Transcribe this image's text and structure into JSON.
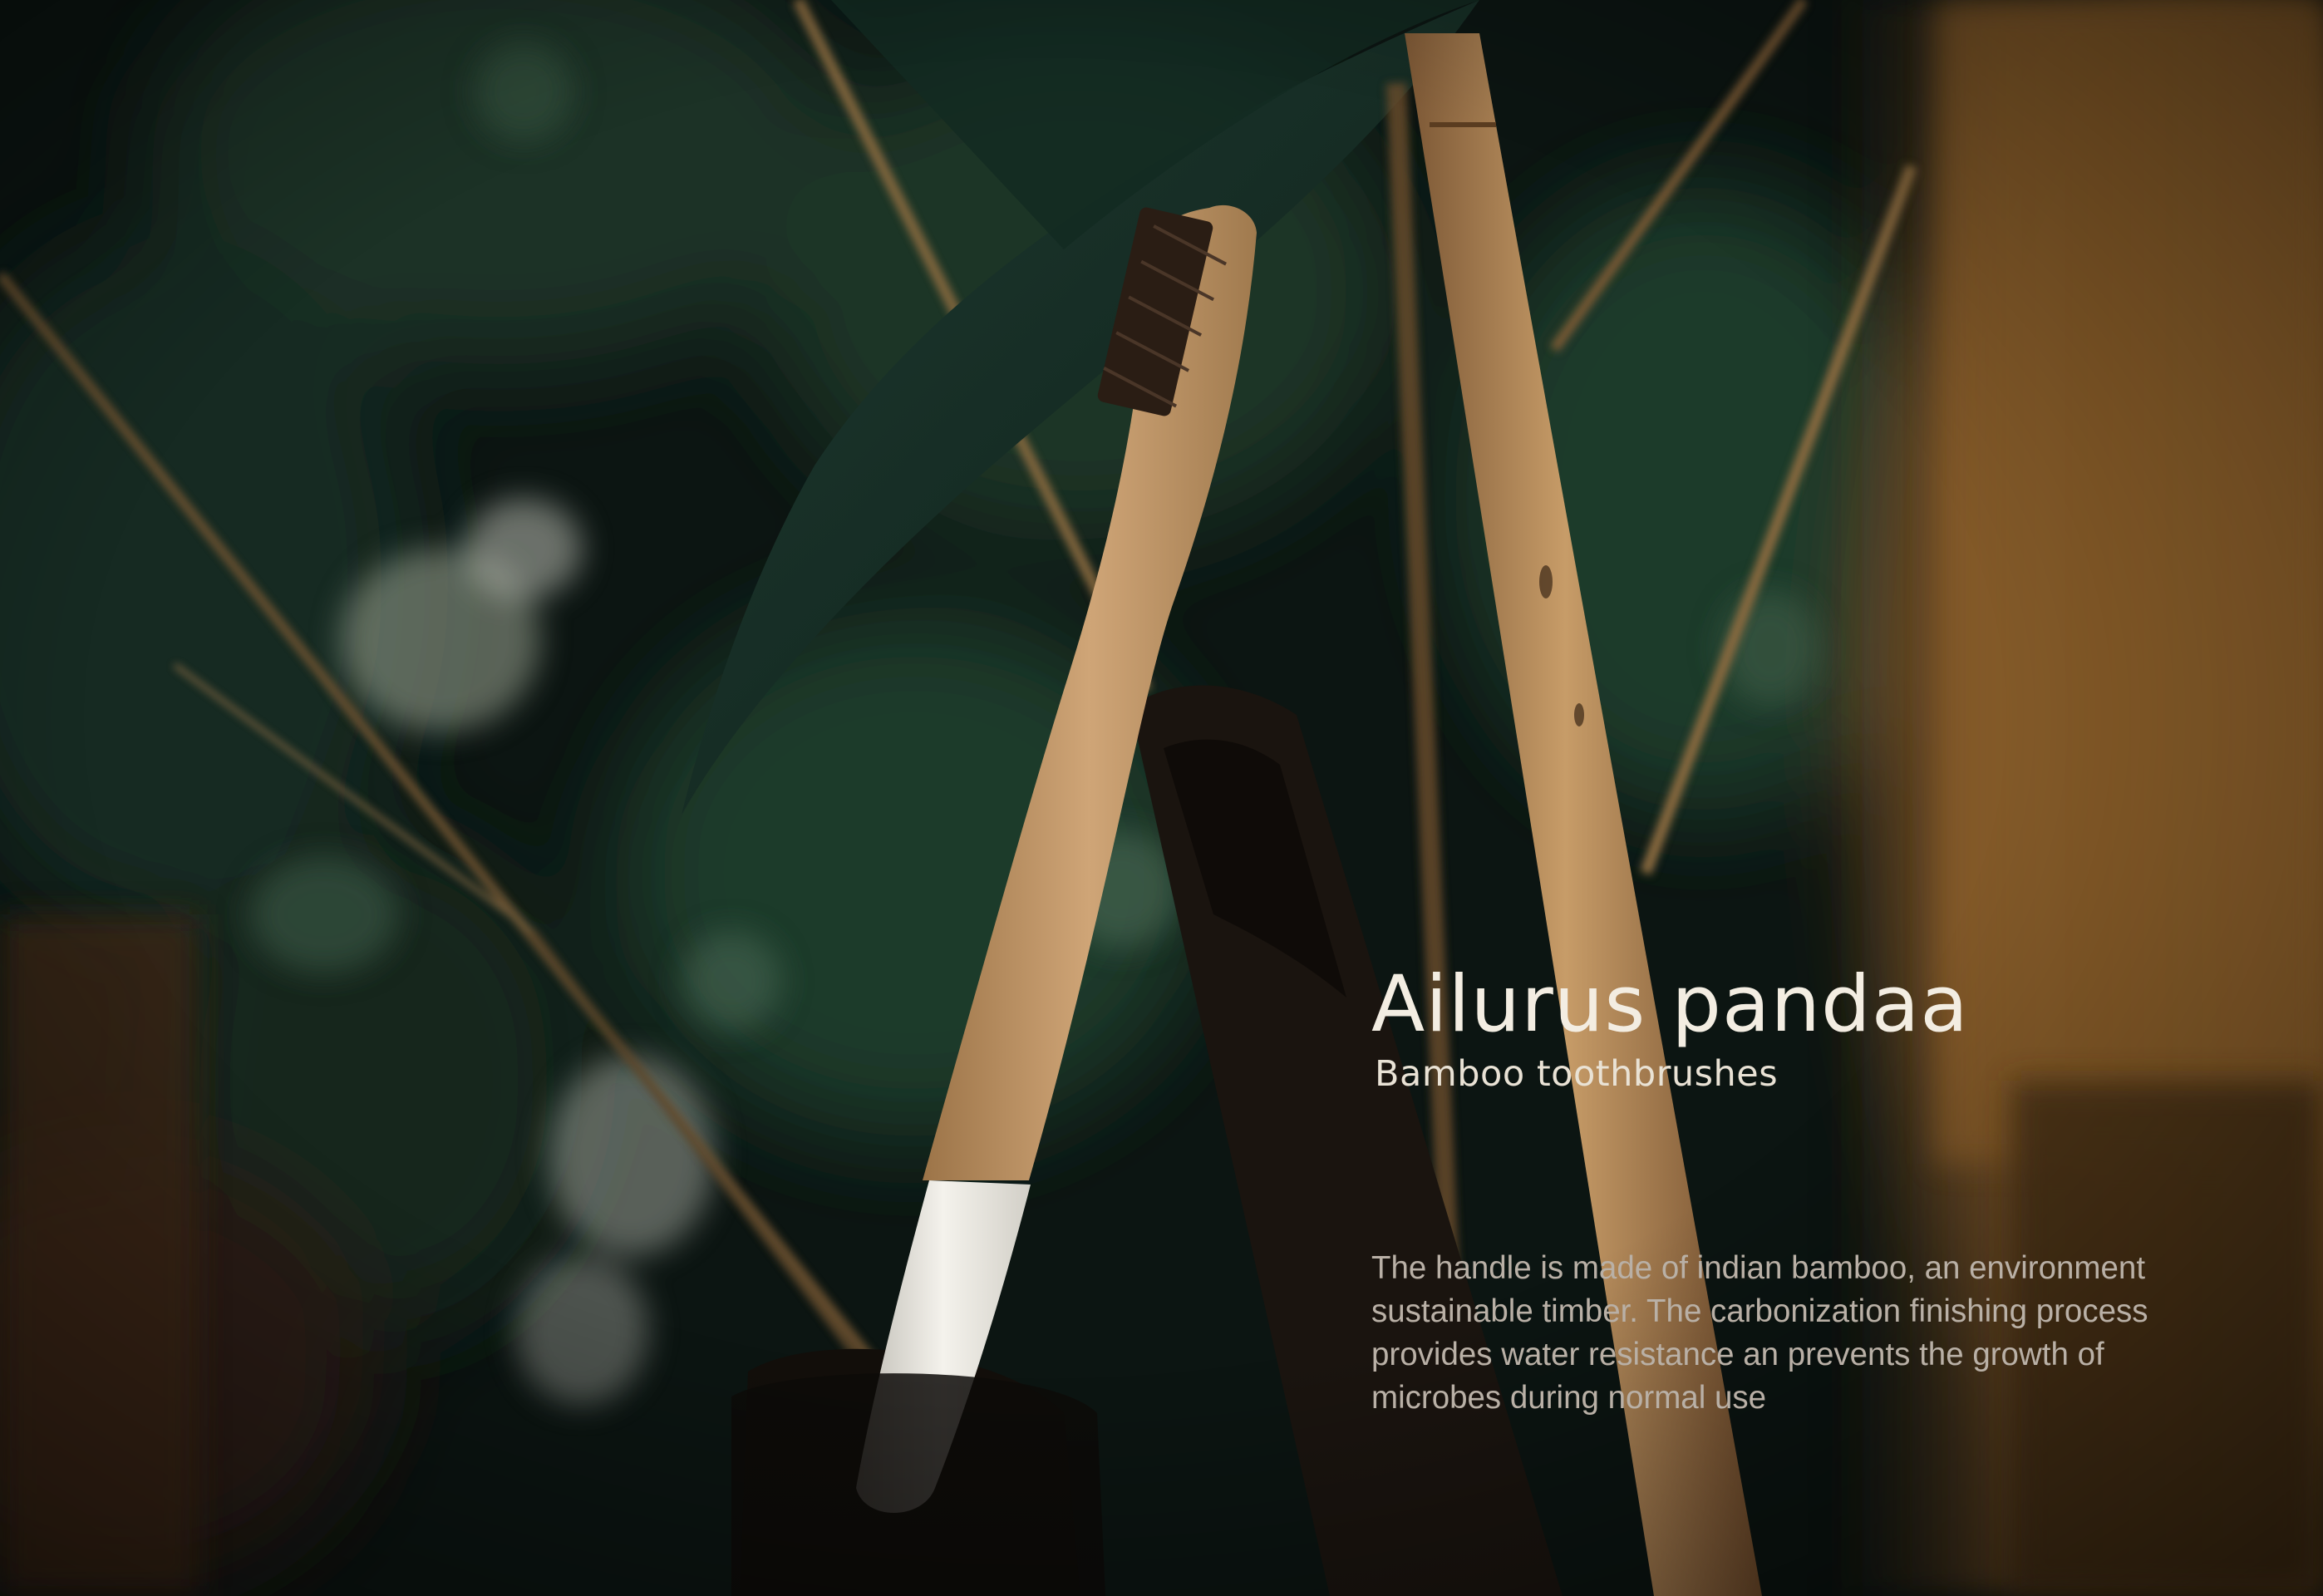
{
  "product": {
    "title": "Ailurus pandaa",
    "subtitle": "Bamboo toothbrushes",
    "description": "The handle is made of indian bamboo, an environment sustainable timber. The carbonization finishing process provides water resistance an prevents the growth of microbes during normal use"
  },
  "palette": {
    "background": "#0b120f",
    "foliage": "#1c3a2c",
    "bamboo": "#b98a55",
    "handle_tip": "#f2f0ea",
    "title_text": "#f3ede2",
    "body_text": "#b9b0a6"
  }
}
